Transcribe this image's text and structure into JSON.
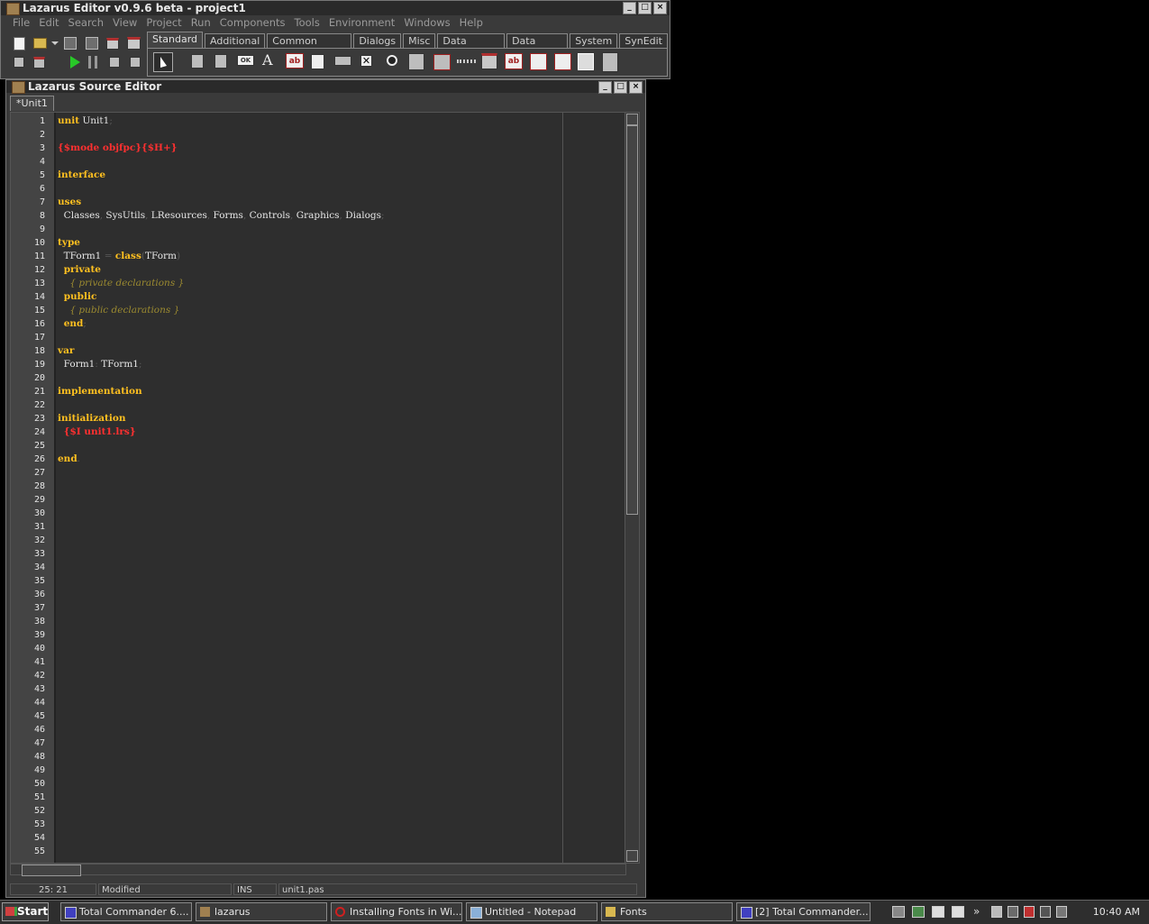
{
  "main_window": {
    "title": "Lazarus Editor v0.9.6 beta - project1",
    "menu": [
      "File",
      "Edit",
      "Search",
      "View",
      "Project",
      "Run",
      "Components",
      "Tools",
      "Environment",
      "Windows",
      "Help"
    ],
    "palette_tabs": [
      "Standard",
      "Additional",
      "Common Controls",
      "Dialogs",
      "Misc",
      "Data Controls",
      "Data Access",
      "System",
      "SynEdit"
    ],
    "active_tab": "Standard",
    "palette_labels": {
      "button": "OK",
      "edit": "ab",
      "label": "A"
    }
  },
  "editor_window": {
    "title": "Lazarus Source Editor",
    "file_tab": "*Unit1",
    "code_lines": [
      [
        [
          "kw",
          "unit"
        ],
        [
          "t",
          " Unit1"
        ],
        [
          "sym",
          ";"
        ]
      ],
      [],
      [
        [
          "dir",
          "{$mode objfpc}{$H+}"
        ]
      ],
      [],
      [
        [
          "kw",
          "interface"
        ]
      ],
      [],
      [
        [
          "kw",
          "uses"
        ]
      ],
      [
        [
          "t",
          "  Classes"
        ],
        [
          "sym",
          ","
        ],
        [
          "t",
          " SysUtils"
        ],
        [
          "sym",
          ","
        ],
        [
          "t",
          " LResources"
        ],
        [
          "sym",
          ","
        ],
        [
          "t",
          " Forms"
        ],
        [
          "sym",
          ","
        ],
        [
          "t",
          " Controls"
        ],
        [
          "sym",
          ","
        ],
        [
          "t",
          " Graphics"
        ],
        [
          "sym",
          ","
        ],
        [
          "t",
          " Dialogs"
        ],
        [
          "sym",
          ";"
        ]
      ],
      [],
      [
        [
          "kw",
          "type"
        ]
      ],
      [
        [
          "t",
          "  TForm1 "
        ],
        [
          "sym",
          "="
        ],
        [
          "t",
          " "
        ],
        [
          "kw",
          "class"
        ],
        [
          "sym",
          "("
        ],
        [
          "t",
          "TForm"
        ],
        [
          "sym",
          ")"
        ]
      ],
      [
        [
          "t",
          "  "
        ],
        [
          "kw",
          "private"
        ]
      ],
      [
        [
          "t",
          "    "
        ],
        [
          "cmt",
          "{ private declarations }"
        ]
      ],
      [
        [
          "t",
          "  "
        ],
        [
          "kw",
          "public"
        ]
      ],
      [
        [
          "t",
          "    "
        ],
        [
          "cmt",
          "{ public declarations }"
        ]
      ],
      [
        [
          "t",
          "  "
        ],
        [
          "kw",
          "end"
        ],
        [
          "sym",
          ";"
        ]
      ],
      [],
      [
        [
          "kw",
          "var"
        ]
      ],
      [
        [
          "t",
          "  Form1"
        ],
        [
          "sym",
          ":"
        ],
        [
          "t",
          " TForm1"
        ],
        [
          "sym",
          ";"
        ]
      ],
      [],
      [
        [
          "kw",
          "implementation"
        ]
      ],
      [],
      [
        [
          "kw",
          "initialization"
        ]
      ],
      [
        [
          "t",
          "  "
        ],
        [
          "dir",
          "{$I unit1.lrs}"
        ]
      ],
      [],
      [
        [
          "kw",
          "end"
        ],
        [
          "sym",
          "."
        ]
      ]
    ],
    "line_numbers": [
      "1",
      "2",
      "3",
      "4",
      "5",
      "6",
      "7",
      "8",
      "9",
      "10",
      "11",
      "12",
      "13",
      "14",
      "15",
      "16",
      "17",
      "18",
      "19",
      "20",
      "21",
      "22",
      "23",
      "24",
      "25",
      "26",
      "27",
      "28",
      "29",
      "30",
      "31",
      "32",
      "33",
      "34",
      "35",
      "36",
      "37",
      "38",
      "39",
      "40",
      "41",
      "42",
      "43",
      "44",
      "45",
      "46",
      "47",
      "48",
      "49",
      "50",
      "51",
      "52",
      "53",
      "54",
      "55"
    ],
    "status": {
      "position": "25: 21",
      "modified": "Modified",
      "mode": "INS",
      "filename": "unit1.pas"
    }
  },
  "taskbar": {
    "start_label": "Start",
    "tasks": [
      "Total Commander 6....",
      "lazarus",
      "Installing Fonts in Wi...",
      "Untitled - Notepad",
      "Fonts",
      "[2] Total Commander..."
    ],
    "clock": "10:40 AM"
  },
  "colors": {
    "keyword": "#ffc020",
    "directive": "#ff3030",
    "comment": "#9b8a30",
    "editor_bg": "#2e2e2e"
  }
}
